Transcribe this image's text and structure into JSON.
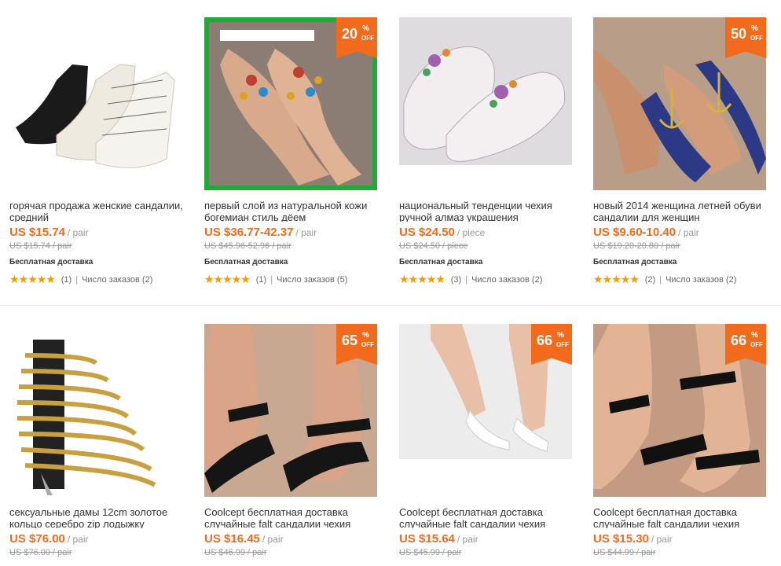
{
  "colors": {
    "accent": "#f26b1d",
    "star": "#f59b00"
  },
  "products": [
    {
      "title": "горячая продажа женские сандалии, средний",
      "price": "US $15.74",
      "unit": "/ pair",
      "old_price": "US $15.74 / pair",
      "shipping": "Бесплатная доставка",
      "stars": "★★★★★",
      "reviews": "(1)",
      "orders": "Число заказов (2)",
      "badge": null,
      "image_icon": "white-black-strappy-sandals"
    },
    {
      "title": "первый слой из натуральной кожи богемиан стиль дёем",
      "price": "US $36.77-42.37",
      "unit": "/ pair",
      "old_price": "US $45.96-52.96 / pair",
      "shipping": "Бесплатная доставка",
      "stars": "★★★★★",
      "reviews": "(1)",
      "orders": "Число заказов (5)",
      "badge": {
        "num": "20",
        "pct": "%",
        "off": "OFF"
      },
      "image_icon": "jeweled-thong-sandal"
    },
    {
      "title": "национальный тенденции чехия ручной алмаз украшения",
      "price": "US $24.50",
      "unit": "/ piece",
      "old_price": "US $24.50 / piece",
      "shipping": "Бесплатная доставка",
      "stars": "★★★★★",
      "reviews": "(3)",
      "orders": "Число заказов (2)",
      "badge": null,
      "image_icon": "beaded-slipper-sandals"
    },
    {
      "title": "новый 2014 женщина летней обуви сандалии для женщин",
      "price": "US $9.60-10.40",
      "unit": "/ pair",
      "old_price": "US $19.20-20.80 / pair",
      "shipping": "Бесплатная доставка",
      "stars": "★★★★★",
      "reviews": "(2)",
      "orders": "Число заказов (2)",
      "badge": {
        "num": "50",
        "pct": "%",
        "off": "OFF"
      },
      "image_icon": "anchor-flat-sandals"
    },
    {
      "title": "сексуальные дамы 12cm золотое кольцо серебро zip лодыжку",
      "price": "US $76.00",
      "unit": "/ pair",
      "old_price": "US $76.00 / pair",
      "shipping": "",
      "stars": "",
      "reviews": "",
      "orders": "",
      "badge": null,
      "image_icon": "gold-heel-sandal"
    },
    {
      "title": "Coolcept бесплатная доставка случайные falt сандалии чехия",
      "price": "US $16.45",
      "unit": "/ pair",
      "old_price": "US $46.99 / pair",
      "shipping": "",
      "stars": "",
      "reviews": "",
      "orders": "",
      "badge": {
        "num": "65",
        "pct": "%",
        "off": "OFF"
      },
      "image_icon": "black-flat-sandals"
    },
    {
      "title": "Coolcept бесплатная доставка случайные falt сандалии чехия",
      "price": "US $15.64",
      "unit": "/ pair",
      "old_price": "US $45.99 / pair",
      "shipping": "",
      "stars": "",
      "reviews": "",
      "orders": "",
      "badge": {
        "num": "66",
        "pct": "%",
        "off": "OFF"
      },
      "image_icon": "white-flat-sandals"
    },
    {
      "title": "Coolcept бесплатная доставка случайные falt сандалии чехия",
      "price": "US $15.30",
      "unit": "/ pair",
      "old_price": "US $44.99 / pair",
      "shipping": "",
      "stars": "",
      "reviews": "",
      "orders": "",
      "badge": {
        "num": "66",
        "pct": "%",
        "off": "OFF"
      },
      "image_icon": "black-ankle-sandals"
    }
  ]
}
